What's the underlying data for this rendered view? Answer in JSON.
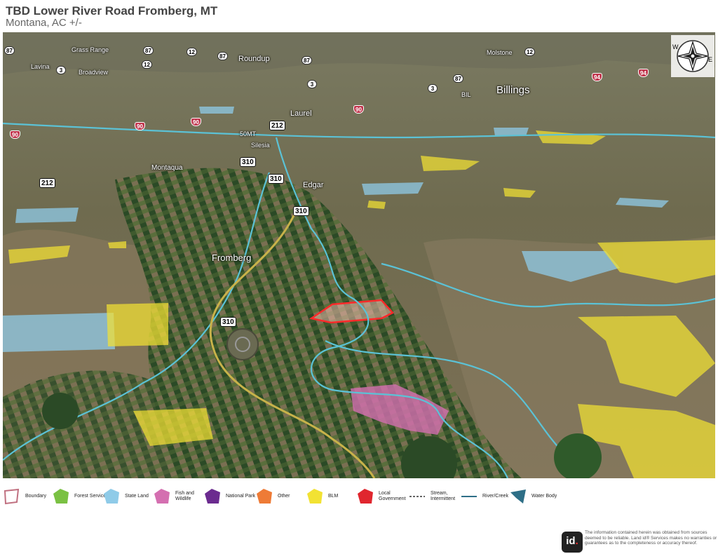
{
  "title": "TBD Lower River Road Fromberg, MT",
  "subtitle": "Montana,  AC +/-",
  "map": {
    "places": [
      {
        "key": "grass_range",
        "text": "Grass Range"
      },
      {
        "key": "lavina",
        "text": "Lavina"
      },
      {
        "key": "broadview",
        "text": "Broadview"
      },
      {
        "key": "roundup",
        "text": "Roundup"
      },
      {
        "key": "molstone",
        "text": "Molstone"
      },
      {
        "key": "billings",
        "text": "Billings"
      },
      {
        "key": "bil",
        "text": "BIL"
      },
      {
        "key": "laurel",
        "text": "Laurel"
      },
      {
        "key": "50mt",
        "text": "50MT"
      },
      {
        "key": "silesia",
        "text": "Silesia"
      },
      {
        "key": "montaqua",
        "text": "Montaqua"
      },
      {
        "key": "edgar",
        "text": "Edgar"
      },
      {
        "key": "fromberg",
        "text": "Fromberg"
      }
    ],
    "shields": [
      "87",
      "87",
      "87",
      "87",
      "87",
      "12",
      "12",
      "12",
      "3",
      "3",
      "3",
      "212",
      "212",
      "310",
      "310",
      "310",
      "310",
      "90",
      "90",
      "90",
      "90",
      "94",
      "94"
    ]
  },
  "compass": {
    "w": "W",
    "e": "E"
  },
  "legend": [
    {
      "key": "boundary",
      "label": "Boundary",
      "color": "#e0a0a8"
    },
    {
      "key": "forest",
      "label": "Forest Service",
      "color": "#7ac143"
    },
    {
      "key": "state",
      "label": "State Land",
      "color": "#8fcbe8"
    },
    {
      "key": "fish",
      "label": "Fish and Wildlife",
      "color": "#d46fb0"
    },
    {
      "key": "park",
      "label": "National Park",
      "color": "#6b2b8f"
    },
    {
      "key": "other",
      "label": "Other",
      "color": "#ee7b36"
    },
    {
      "key": "blm",
      "label": "BLM",
      "color": "#f2e233"
    },
    {
      "key": "local",
      "label": "Local Government",
      "color": "#e0262e"
    },
    {
      "key": "stream",
      "label": "Stream, Intermittent",
      "color": "#333333"
    },
    {
      "key": "river",
      "label": "River/Creek",
      "color": "#2e6f87"
    },
    {
      "key": "water",
      "label": "Water Body",
      "color": "#2e6f87"
    }
  ],
  "disclaimer": "The information contained herein was obtained from sources deemed to be reliable. Land id® Services makes no warranties or guarantees as to the completeness or accuracy thereof.",
  "logo": {
    "text": "id",
    "dot": "."
  }
}
